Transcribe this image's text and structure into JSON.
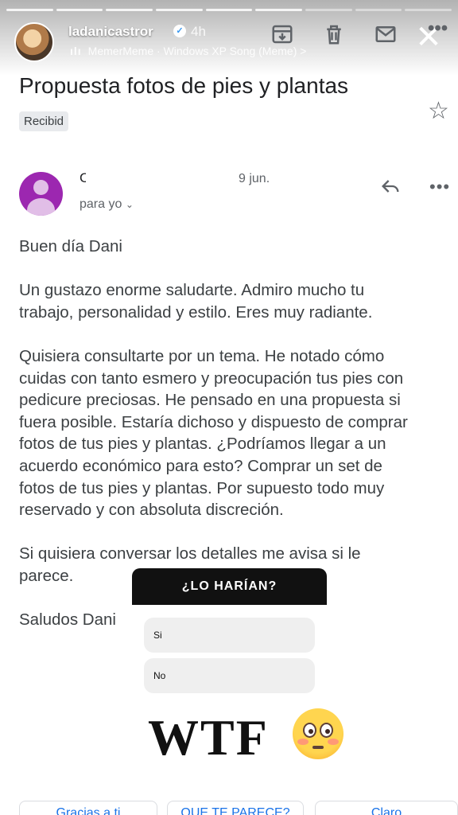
{
  "story": {
    "username": "ladanicastror",
    "time": "4h",
    "music": "MemerMeme · Windows XP Song (Meme) >",
    "progress_segments": 9,
    "close_icon": "close-icon"
  },
  "toolbar": {
    "icons": [
      "archive-icon",
      "delete-icon",
      "mail-icon",
      "more-icon"
    ]
  },
  "email": {
    "subject": "Propuesta fotos de pies y plantas",
    "label": "Recibid",
    "sender_visible": "C",
    "date": "9 jun.",
    "to": "para yo",
    "paragraphs": [
      "Buen día Dani",
      "Un gustazo enorme saludarte. Admiro mucho tu\ntrabajo, personalidad y estilo. Eres muy radiante.",
      "Quisiera consultarte por un tema. He notado cómo\ncuidas con tanto esmero y preocupación tus pies con\npedicure preciosas.  He pensado en una propuesta si\nfuera posible. Estaría dichoso y dispuesto de comprar\nfotos de tus pies y plantas. ¿Podríamos llegar a un\nacuerdo económico para esto? Comprar un set de\nfotos de tus pies y plantas. Por supuesto todo muy\nreservado y con absoluta discreción.",
      "Si quisiera conversar los detalles me avisa si le\nparece.",
      "Saludos Dani"
    ]
  },
  "poll": {
    "question": "¿LO HARÍAN?",
    "options": [
      "Si",
      "No"
    ]
  },
  "caption": "WTF",
  "emoji": "flushed-face",
  "chips": [
    "Gracias a ti",
    "QUE TE PARECE?",
    "Claro"
  ],
  "colors": {
    "sender_avatar": "#9c27b0",
    "link": "#1a73e8",
    "text": "#3c4043"
  }
}
